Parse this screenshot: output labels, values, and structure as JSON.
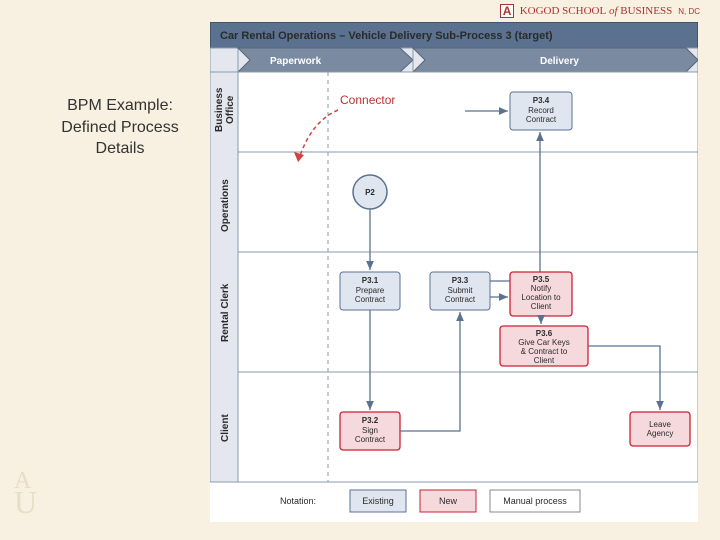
{
  "slide_title_l1": "BPM Example:",
  "slide_title_l2": "Defined Process",
  "slide_title_l3": "Details",
  "header": {
    "brand_prefix": "KOGOD",
    "brand_of": "SCHOOL",
    "brand_it": "of",
    "brand_suffix": "BUSINESS",
    "loc": "N, DC"
  },
  "diagram": {
    "title": "Car Rental Operations – Vehicle Delivery Sub-Process 3 (target)",
    "phases": {
      "p1": "Paperwork",
      "p2": "Delivery"
    },
    "lanes": {
      "l1": "Business\nOffice",
      "l2": "Operations",
      "l3": "Rental Clerk",
      "l4": "Client"
    },
    "annotation": "Connector",
    "boxes": {
      "p2": {
        "id": "P2",
        "label": ""
      },
      "p31": {
        "id": "P3.1",
        "label": "Prepare\nContract"
      },
      "p32": {
        "id": "P3.2",
        "label": "Sign\nContract"
      },
      "p33": {
        "id": "P3.3",
        "label": "Submit\nContract"
      },
      "p34": {
        "id": "P3.4",
        "label": "Record\nContract"
      },
      "p35": {
        "id": "P3.5",
        "label": "Notify\nLocation to\nClient"
      },
      "p36": {
        "id": "P3.6",
        "label": "Give Car Keys\n& Contract to\nClient"
      },
      "leave": {
        "id": "",
        "label": "Leave\nAgency"
      }
    },
    "legend": {
      "label": "Notation:",
      "existing": "Existing",
      "new": "New",
      "manual": "Manual process"
    }
  }
}
